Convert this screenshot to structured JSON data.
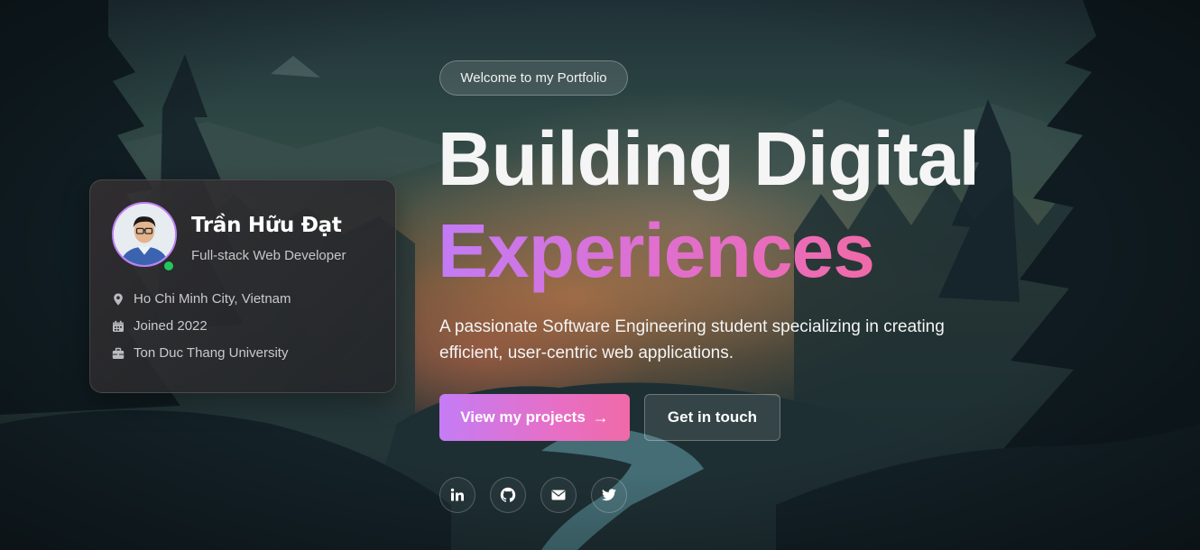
{
  "profile": {
    "name": "Trần Hữu Đạt",
    "role": "Full-stack Web Developer",
    "status": "online",
    "location": "Ho Chi Minh City, Vietnam",
    "joined": "Joined 2022",
    "organization": "Ton Duc Thang University"
  },
  "hero": {
    "badge": "Welcome to my Portfolio",
    "headline_line1": "Building Digital",
    "headline_line2": "Experiences",
    "subtitle": "A passionate Software Engineering student specializing in creating efficient, user-centric web applications."
  },
  "buttons": {
    "primary_label": "View my projects",
    "primary_icon": "arrow-right-icon",
    "secondary_label": "Get in touch"
  },
  "social_links": [
    "linkedin-icon",
    "github-icon",
    "envelope-icon",
    "twitter-icon"
  ],
  "colors": {
    "accent_start": "#c27bf4",
    "accent_end": "#f06aa8",
    "online": "#22c55e"
  }
}
